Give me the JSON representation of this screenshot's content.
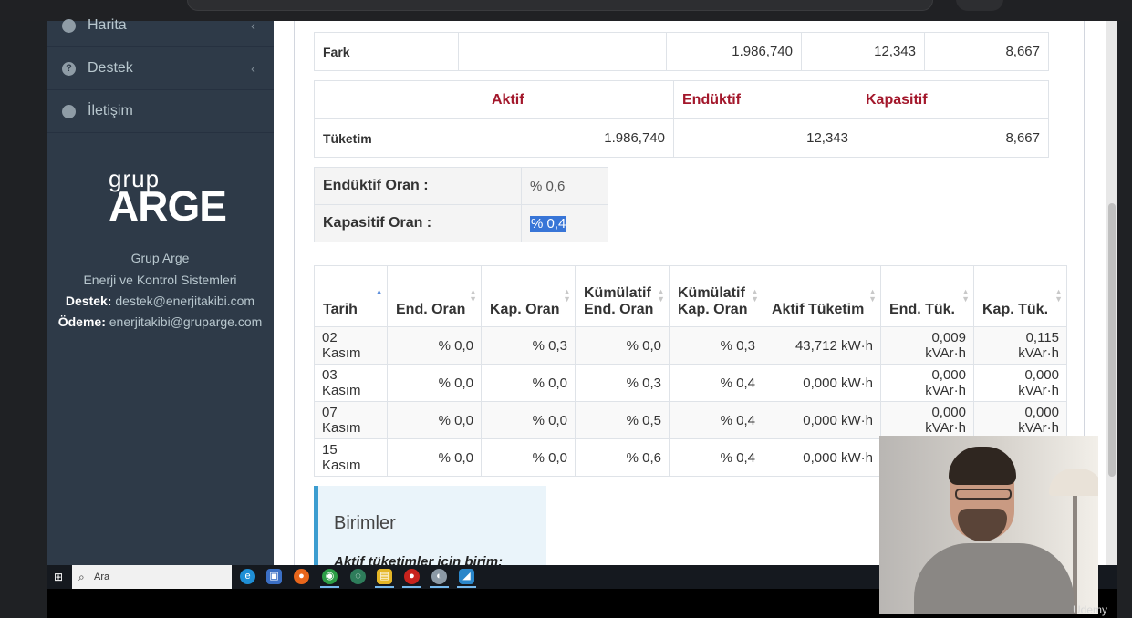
{
  "browser": {
    "url_partial": "…y … g p g…"
  },
  "sidebar": {
    "items": [
      {
        "label": "Harita",
        "icon": "map-marker-icon"
      },
      {
        "label": "Destek",
        "icon": "question-circle-icon"
      },
      {
        "label": "İletişim",
        "icon": "globe-icon"
      }
    ],
    "logo_top": "grup",
    "logo_bottom": "ARGE",
    "company": "Grup Arge",
    "subtitle": "Enerji ve Kontrol Sistemleri",
    "support_label": "Destek:",
    "support_email": "destek@enerjitakibi.com",
    "payment_label": "Ödeme:",
    "payment_email": "enerjitakibi@gruparge.com"
  },
  "fark_row": {
    "label": "Fark",
    "empty": "",
    "aktif": "1.986,740",
    "enduktif": "12,343",
    "kapasitif": "8,667"
  },
  "tuketim_table": {
    "headers": [
      "",
      "Aktif",
      "Endüktif",
      "Kapasitif"
    ],
    "label": "Tüketim",
    "aktif": "1.986,740",
    "enduktif": "12,343",
    "kapasitif": "8,667"
  },
  "oran": {
    "enduktif_label": "Endüktif Oran :",
    "enduktif_value": "% 0,6",
    "kapasitif_label": "Kapasitif Oran :",
    "kapasitif_value": "% 0,4"
  },
  "daily_table": {
    "headers": [
      "Tarih",
      "End. Oran",
      "Kap. Oran",
      "Kümülatif End. Oran",
      "Kümülatif Kap. Oran",
      "Aktif Tüketim",
      "End. Tük.",
      "Kap. Tük."
    ],
    "header_lines": [
      [
        "Tarih"
      ],
      [
        "End. Oran"
      ],
      [
        "Kap. Oran"
      ],
      [
        "Kümülatif",
        "End. Oran"
      ],
      [
        "Kümülatif",
        "Kap. Oran"
      ],
      [
        "Aktif Tüketim"
      ],
      [
        "End. Tük."
      ],
      [
        "Kap. Tük."
      ]
    ],
    "rows": [
      [
        "02 Kasım",
        "% 0,0",
        "% 0,3",
        "% 0,0",
        "% 0,3",
        "43,712 kW·h",
        "0,009 kVAr·h",
        "0,115 kVAr·h"
      ],
      [
        "03 Kasım",
        "% 0,0",
        "% 0,0",
        "% 0,3",
        "% 0,4",
        "0,000 kW·h",
        "0,000 kVAr·h",
        "0,000 kVAr·h"
      ],
      [
        "07 Kasım",
        "% 0,0",
        "% 0,0",
        "% 0,5",
        "% 0,4",
        "0,000 kW·h",
        "0,000 kVAr·h",
        "0,000 kVAr·h"
      ],
      [
        "15 Kasım",
        "% 0,0",
        "% 0,0",
        "% 0,6",
        "% 0,4",
        "0,000 kW·h",
        "",
        ""
      ]
    ]
  },
  "birimler": {
    "title": "Birimler",
    "subtitle": "Aktif tüketimler için birim:"
  },
  "taskbar": {
    "search_placeholder": "Ara"
  },
  "watermark": "Udemy",
  "colors": {
    "sidebar": "#2e3a48",
    "accent_red": "#a3172b",
    "selection": "#3875d7",
    "callout_border": "#3c9dd0"
  }
}
